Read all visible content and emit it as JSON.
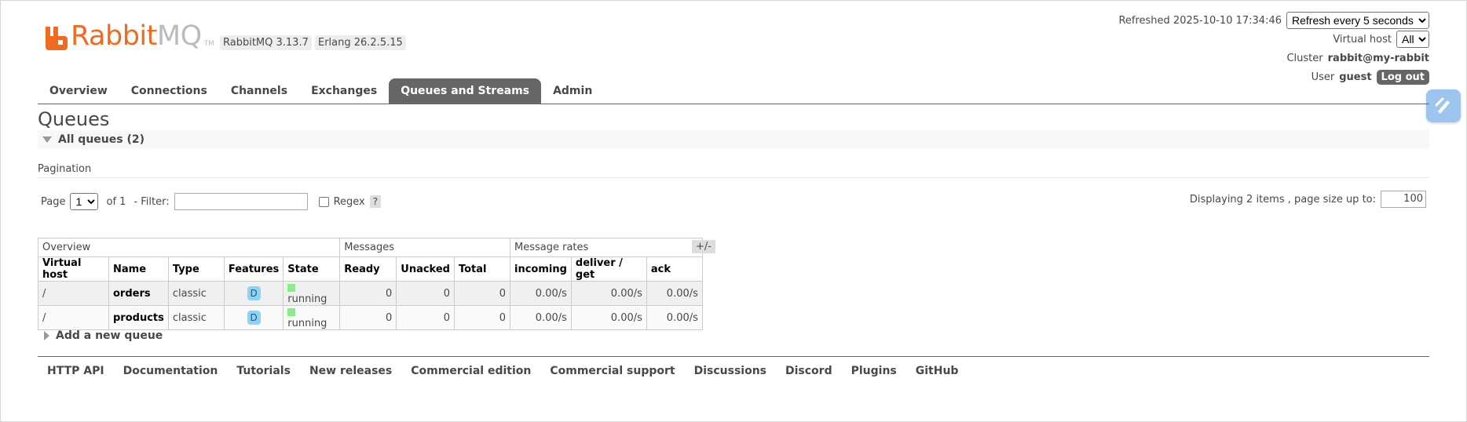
{
  "logo": {
    "word1": "Rabbit",
    "word2": "MQ",
    "tm": "TM"
  },
  "versions": {
    "rabbitmq": "RabbitMQ 3.13.7",
    "erlang": "Erlang 26.2.5.15"
  },
  "header": {
    "refreshed": "Refreshed 2025-10-10 17:34:46",
    "refresh_option": "Refresh every 5 seconds",
    "vhost_label": "Virtual host",
    "vhost_value": "All",
    "cluster_label": "Cluster",
    "cluster_value": "rabbit@my-rabbit",
    "user_label": "User",
    "user_value": "guest",
    "logout": "Log out"
  },
  "tabs": [
    {
      "label": "Overview"
    },
    {
      "label": "Connections"
    },
    {
      "label": "Channels"
    },
    {
      "label": "Exchanges"
    },
    {
      "label": "Queues and Streams",
      "active": true
    },
    {
      "label": "Admin"
    }
  ],
  "page_title": "Queues",
  "section_title": "All queues (2)",
  "pagination": {
    "label": "Pagination",
    "page_label": "Page",
    "page_value": "1",
    "of_label": "of 1",
    "filter_label": "- Filter:",
    "filter_value": "",
    "regex_label": "Regex",
    "help": "?",
    "display_text": "Displaying 2 items , page size up to:",
    "page_size": "100"
  },
  "table": {
    "groups": [
      "Overview",
      "Messages",
      "Message rates"
    ],
    "plusminus": "+/-",
    "columns": [
      "Virtual host",
      "Name",
      "Type",
      "Features",
      "State",
      "Ready",
      "Unacked",
      "Total",
      "incoming",
      "deliver / get",
      "ack"
    ],
    "rows": [
      {
        "vhost": "/",
        "name": "orders",
        "type": "classic",
        "feature": "D",
        "state": "running",
        "ready": "0",
        "unacked": "0",
        "total": "0",
        "incoming": "0.00/s",
        "deliver": "0.00/s",
        "ack": "0.00/s"
      },
      {
        "vhost": "/",
        "name": "products",
        "type": "classic",
        "feature": "D",
        "state": "running",
        "ready": "0",
        "unacked": "0",
        "total": "0",
        "incoming": "0.00/s",
        "deliver": "0.00/s",
        "ack": "0.00/s"
      }
    ]
  },
  "add_queue": "Add a new queue",
  "footer": [
    "HTTP API",
    "Documentation",
    "Tutorials",
    "New releases",
    "Commercial edition",
    "Commercial support",
    "Discussions",
    "Discord",
    "Plugins",
    "GitHub"
  ],
  "colors": {
    "brand_orange": "#f06b22",
    "tab_active": "#666666",
    "running": "#88ee88"
  },
  "icons": {
    "float": "pen-sparkle-icon"
  }
}
